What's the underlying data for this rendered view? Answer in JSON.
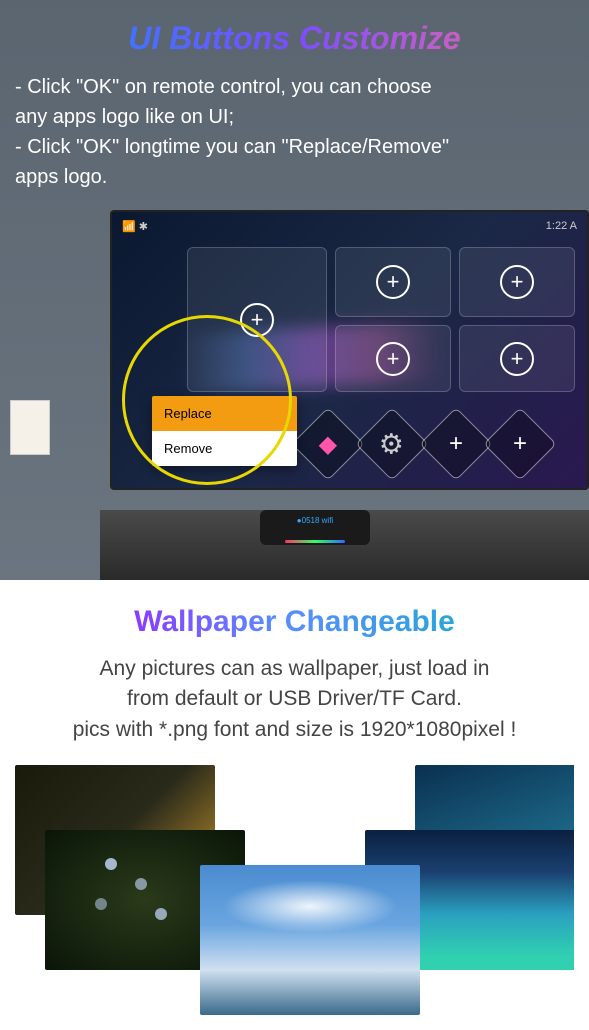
{
  "section1": {
    "title": "UI Buttons Customize",
    "instruction1": "- Click \"OK\" on remote control, you can choose",
    "instruction1b": "  any apps logo like on UI;",
    "instruction2": "- Click \"OK\" longtime you can \"Replace/Remove\"",
    "instruction2b": "  apps logo."
  },
  "tv": {
    "statusIcons": "📶 ✱",
    "time": "1:22 A",
    "tileGlyph": "+",
    "contextMenu": {
      "replace": "Replace",
      "remove": "Remove"
    },
    "bottomPlus": "+",
    "boxDisplay": "●0518 wifi"
  },
  "icons": {
    "gear": "⚙",
    "colorTile": "◆"
  },
  "section2": {
    "titleWord1": "Wallpaper",
    "titleWord2": "Changeable",
    "desc1": "Any pictures can as wallpaper, just load in",
    "desc2": "from default or USB Driver/TF Card.",
    "desc3": "pics with *.png font and size is 1920*1080pixel !"
  }
}
